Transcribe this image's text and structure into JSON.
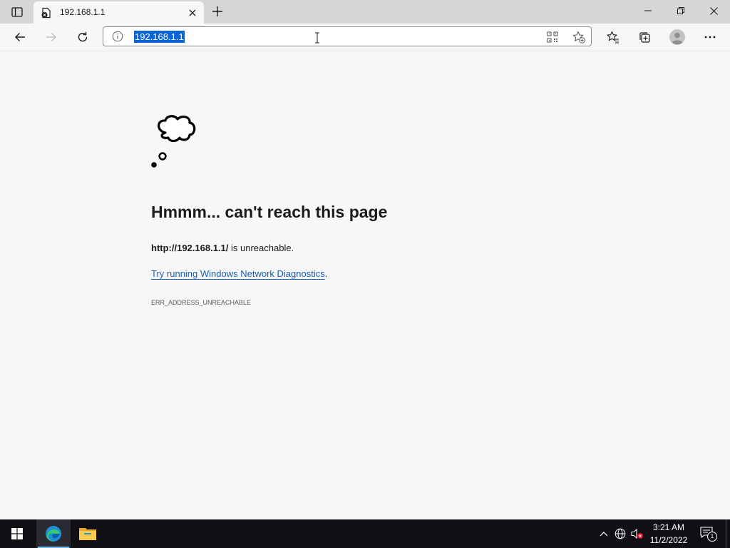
{
  "browser": {
    "tab": {
      "title": "192.168.1.1"
    },
    "address_bar": {
      "url": "192.168.1.1"
    }
  },
  "error_page": {
    "heading": "Hmmm... can't reach this page",
    "url_bold": "http://192.168.1.1/",
    "unreachable_text": " is unreachable.",
    "diagnostics_link": "Try running Windows Network Diagnostics",
    "diagnostics_suffix": ".",
    "error_code": "ERR_ADDRESS_UNREACHABLE"
  },
  "taskbar": {
    "clock": {
      "time": "3:21 AM",
      "date": "11/2/2022"
    },
    "notification_count": "1"
  },
  "colors": {
    "accent": "#0a64d6",
    "link": "#1a5fb4",
    "taskbar": "#0f0f14",
    "page_background": "#f7f7f7"
  },
  "icons": [
    "tab-actions-icon",
    "tab-favicon",
    "tab-close-icon",
    "new-tab-icon",
    "minimize-icon",
    "maximize-icon",
    "close-icon",
    "back-icon",
    "forward-icon",
    "refresh-icon",
    "info-icon",
    "qr-code-icon",
    "add-favorite-icon",
    "favorites-icon",
    "collections-icon",
    "profile-icon",
    "more-icon",
    "thought-bubble-icon",
    "windows-start-icon",
    "edge-icon",
    "file-explorer-icon",
    "chevron-up-icon",
    "network-icon",
    "volume-muted-icon",
    "notifications-icon"
  ]
}
